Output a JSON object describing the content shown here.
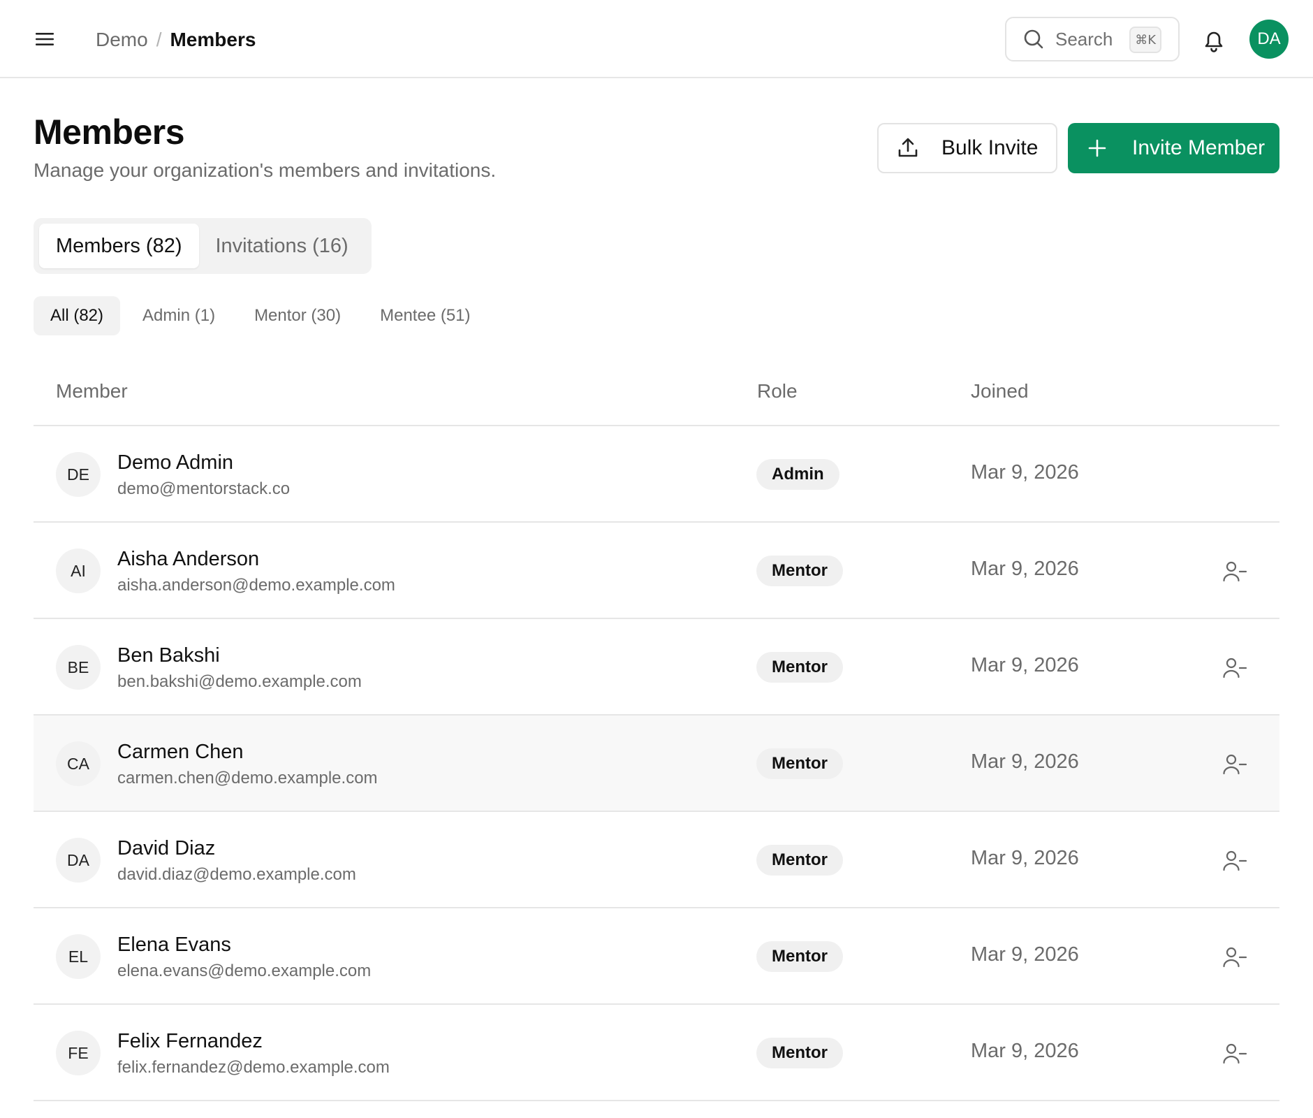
{
  "header": {
    "breadcrumb_root": "Demo",
    "breadcrumb_sep": "/",
    "breadcrumb_current": "Members",
    "search_label": "Search",
    "search_shortcut": "⌘K",
    "user_initials": "DA",
    "icons": [
      "menu-icon",
      "search-icon",
      "bell-icon"
    ]
  },
  "page": {
    "title": "Members",
    "subtitle": "Manage your organization's members and invitations.",
    "bulk_invite_label": "Bulk Invite",
    "invite_member_label": "Invite Member"
  },
  "tabs": [
    {
      "label": "Members (82)",
      "active": true
    },
    {
      "label": "Invitations (16)",
      "active": false
    }
  ],
  "filters": [
    {
      "label": "All (82)",
      "active": true
    },
    {
      "label": "Admin (1)",
      "active": false
    },
    {
      "label": "Mentor (30)",
      "active": false
    },
    {
      "label": "Mentee (51)",
      "active": false
    }
  ],
  "table": {
    "columns": [
      "Member",
      "Role",
      "Joined"
    ],
    "rows": [
      {
        "initials": "DE",
        "name": "Demo Admin",
        "email": "demo@mentorstack.co",
        "role": "Admin",
        "joined": "Mar 9, 2026",
        "removable": false
      },
      {
        "initials": "AI",
        "name": "Aisha Anderson",
        "email": "aisha.anderson@demo.example.com",
        "role": "Mentor",
        "joined": "Mar 9, 2026",
        "removable": true
      },
      {
        "initials": "BE",
        "name": "Ben Bakshi",
        "email": "ben.bakshi@demo.example.com",
        "role": "Mentor",
        "joined": "Mar 9, 2026",
        "removable": true
      },
      {
        "initials": "CA",
        "name": "Carmen Chen",
        "email": "carmen.chen@demo.example.com",
        "role": "Mentor",
        "joined": "Mar 9, 2026",
        "removable": true
      },
      {
        "initials": "DA",
        "name": "David Diaz",
        "email": "david.diaz@demo.example.com",
        "role": "Mentor",
        "joined": "Mar 9, 2026",
        "removable": true
      },
      {
        "initials": "EL",
        "name": "Elena Evans",
        "email": "elena.evans@demo.example.com",
        "role": "Mentor",
        "joined": "Mar 9, 2026",
        "removable": true
      },
      {
        "initials": "FE",
        "name": "Felix Fernandez",
        "email": "felix.fernandez@demo.example.com",
        "role": "Mentor",
        "joined": "Mar 9, 2026",
        "removable": true
      }
    ]
  },
  "colors": {
    "accent": "#0a9160",
    "border": "#e6e6e6",
    "muted_text": "#6b6b6b",
    "hover_row": "#f8f8f8"
  }
}
